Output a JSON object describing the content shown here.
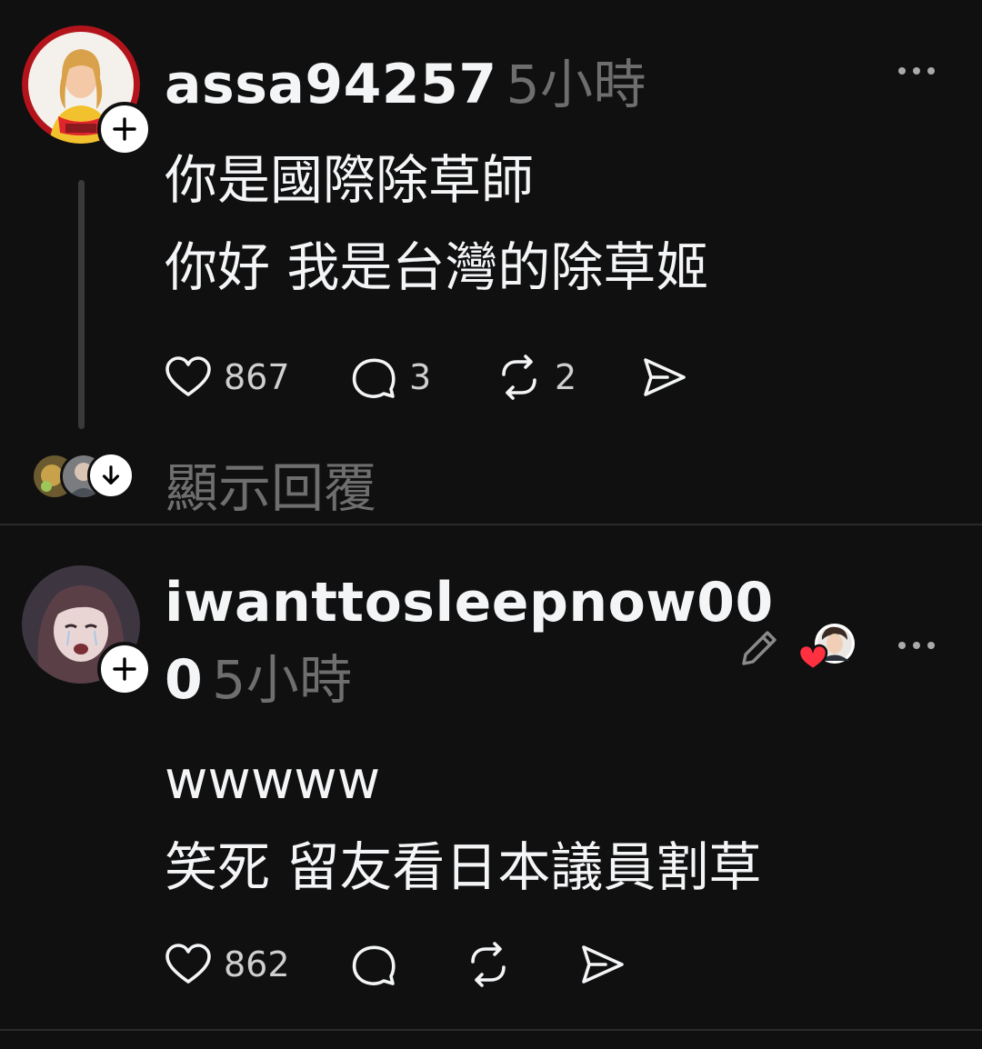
{
  "posts": [
    {
      "username": "assa94257",
      "time": "5小時",
      "lines": [
        "你是國際除草師",
        "你好 我是台灣的除草姬"
      ],
      "likes": "867",
      "comments": "3",
      "reposts": "2",
      "show_replies": "顯示回覆"
    },
    {
      "username_line1": "iwanttosleepnow00",
      "username_line2": "0",
      "time": "5小時",
      "lines": [
        "wwwww",
        "笑死 留友看日本議員割草"
      ],
      "likes": "862"
    }
  ],
  "colors": {
    "background": "#101010",
    "text": "#f3f5f7",
    "muted": "#6e6e6e",
    "divider": "#2a2a2a",
    "liked_heart": "#ff3040"
  },
  "icons": [
    "follow-plus-icon",
    "more-icon",
    "heart-icon",
    "comment-icon",
    "repost-icon",
    "share-icon",
    "arrow-down-icon",
    "pencil-icon"
  ]
}
